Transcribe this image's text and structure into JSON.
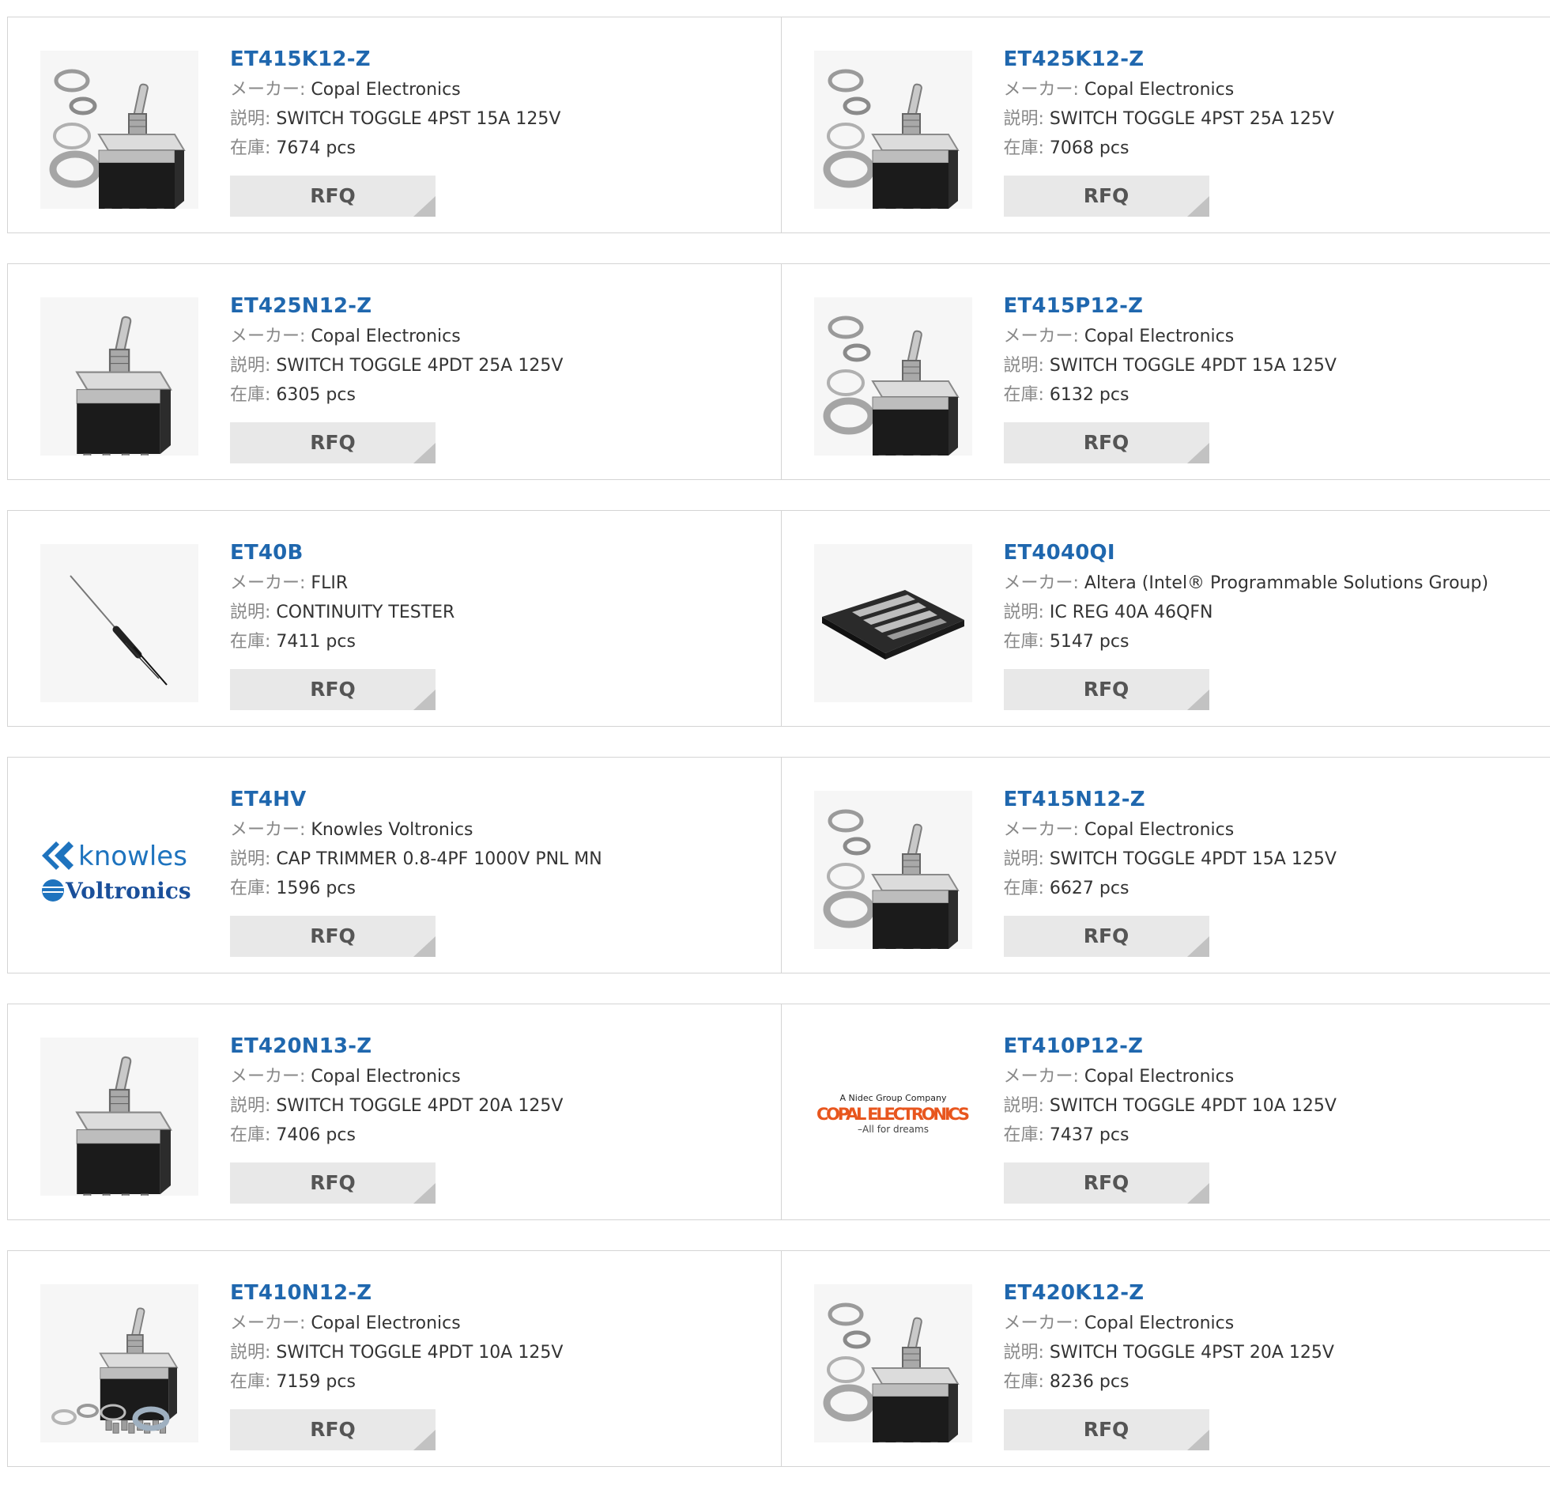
{
  "labels": {
    "maker": "メーカー:",
    "desc": "説明:",
    "stock": "在庫:",
    "rfq": "RFQ"
  },
  "products": [
    {
      "pn": "ET415K12-Z",
      "maker": "Copal Electronics",
      "desc": "SWITCH TOGGLE 4PST 15A 125V",
      "stock": "7674 pcs",
      "image": "toggle-switch-with-washers"
    },
    {
      "pn": "ET425K12-Z",
      "maker": "Copal Electronics",
      "desc": "SWITCH TOGGLE 4PST 25A 125V",
      "stock": "7068 pcs",
      "image": "toggle-switch-with-washers"
    },
    {
      "pn": "ET425N12-Z",
      "maker": "Copal Electronics",
      "desc": "SWITCH TOGGLE 4PDT 25A 125V",
      "stock": "6305 pcs",
      "image": "toggle-switch"
    },
    {
      "pn": "ET415P12-Z",
      "maker": "Copal Electronics",
      "desc": "SWITCH TOGGLE 4PDT 15A 125V",
      "stock": "6132 pcs",
      "image": "toggle-switch-with-washers"
    },
    {
      "pn": "ET40B",
      "maker": "FLIR",
      "desc": "CONTINUITY TESTER",
      "stock": "7411 pcs",
      "image": "continuity-tester-probe"
    },
    {
      "pn": "ET4040QI",
      "maker": "Altera (Intel® Programmable Solutions Group)",
      "desc": "IC REG 40A 46QFN",
      "stock": "5147 pcs",
      "image": "qfn-chip"
    },
    {
      "pn": "ET4HV",
      "maker": "Knowles Voltronics",
      "desc": "CAP TRIMMER 0.8-4PF 1000V PNL MN",
      "stock": "1596 pcs",
      "image": "knowles-voltronics-logo",
      "logo": {
        "line1": "knowles",
        "line2": "Voltronics"
      }
    },
    {
      "pn": "ET415N12-Z",
      "maker": "Copal Electronics",
      "desc": "SWITCH TOGGLE 4PDT 15A 125V",
      "stock": "6627 pcs",
      "image": "toggle-switch-with-washers"
    },
    {
      "pn": "ET420N13-Z",
      "maker": "Copal Electronics",
      "desc": "SWITCH TOGGLE 4PDT 20A 125V",
      "stock": "7406 pcs",
      "image": "toggle-switch"
    },
    {
      "pn": "ET410P12-Z",
      "maker": "Copal Electronics",
      "desc": "SWITCH TOGGLE 4PDT 10A 125V",
      "stock": "7437 pcs",
      "image": "copal-electronics-logo",
      "logo": {
        "line1": "A Nidec Group Company",
        "line2": "COPAL ELECTRONICS",
        "line3": "–All for dreams"
      }
    },
    {
      "pn": "ET410N12-Z",
      "maker": "Copal Electronics",
      "desc": "SWITCH TOGGLE 4PDT 10A 125V",
      "stock": "7159 pcs",
      "image": "toggle-switch-with-washers-below"
    },
    {
      "pn": "ET420K12-Z",
      "maker": "Copal Electronics",
      "desc": "SWITCH TOGGLE 4PST 20A 125V",
      "stock": "8236 pcs",
      "image": "toggle-switch-with-washers"
    }
  ],
  "colors": {
    "part_link": "#1f67ae",
    "rfq_bg": "#e8e8e8",
    "border": "#d4d4d4",
    "knowles_blue": "#1e73be",
    "copal_orange": "#e8561e"
  }
}
